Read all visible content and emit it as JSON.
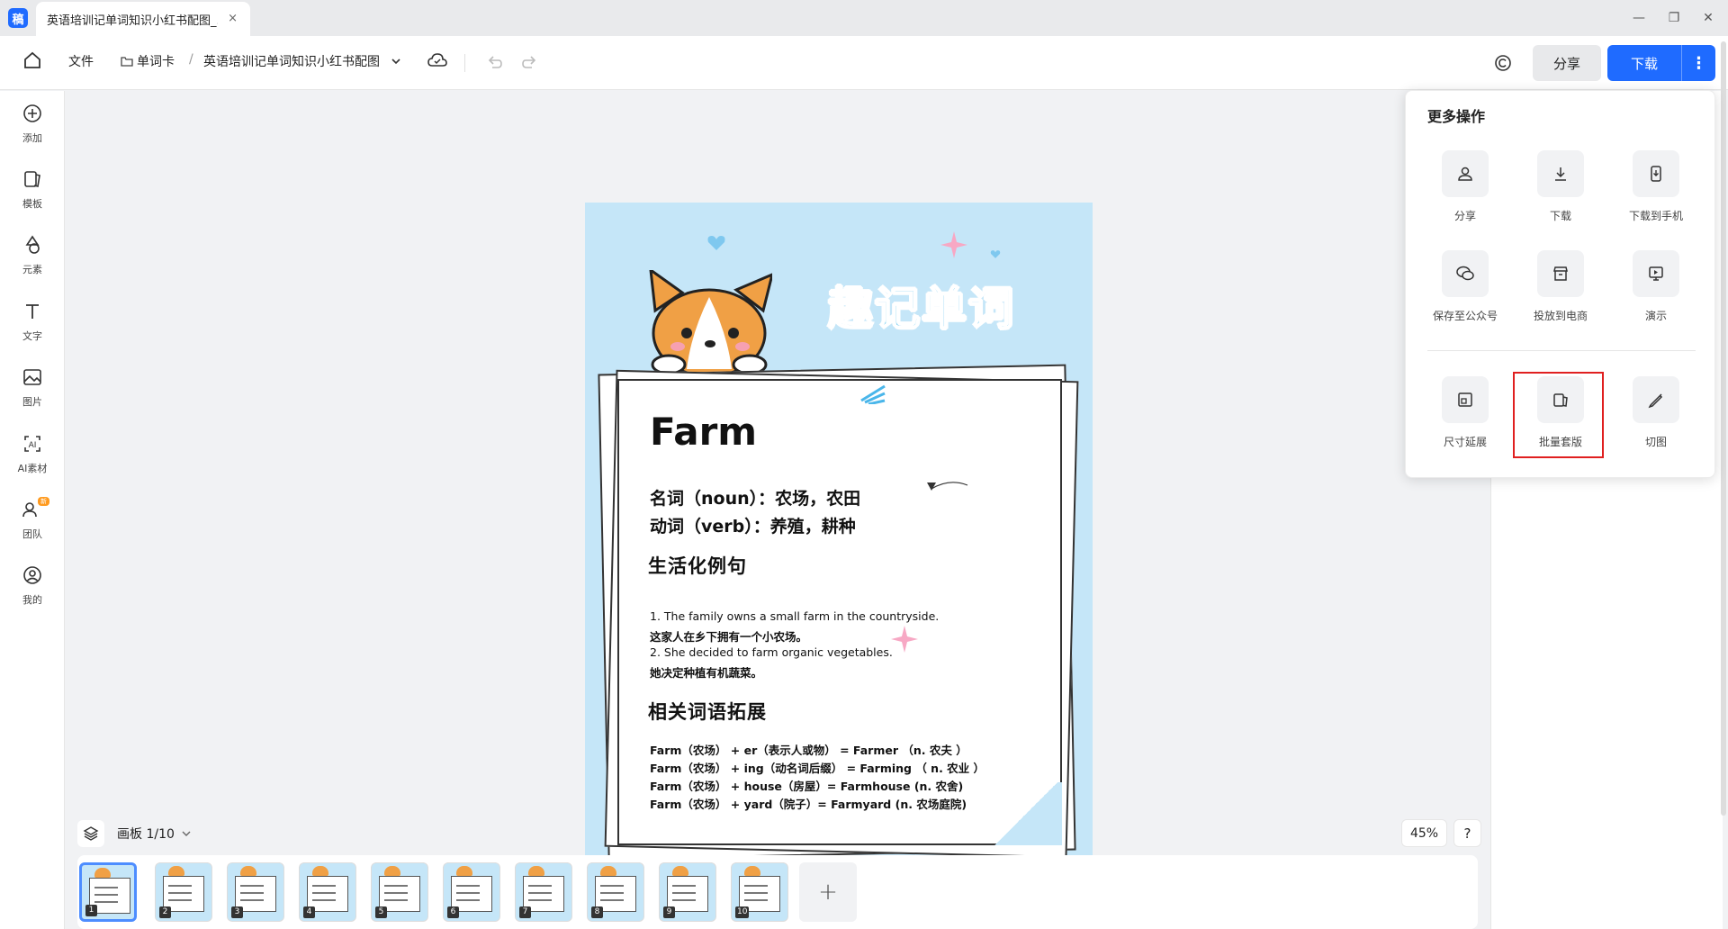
{
  "window": {
    "logo_text": "稿",
    "tab_title": "英语培训记单词知识小红书配图_...",
    "tab_close": "×",
    "minimize": "—",
    "restore": "❐",
    "close": "✕"
  },
  "toolbar": {
    "file_label": "文件",
    "folder_label": "单词卡",
    "separator": "/",
    "doc_title": "英语培训记单词知识小红书配图",
    "share_label": "分享",
    "download_label": "下载",
    "more_glyph": "⋮"
  },
  "sidebar": {
    "items": [
      {
        "label": "添加",
        "icon": "plus-circle-icon"
      },
      {
        "label": "模板",
        "icon": "template-icon"
      },
      {
        "label": "元素",
        "icon": "shapes-icon"
      },
      {
        "label": "文字",
        "icon": "text-icon"
      },
      {
        "label": "图片",
        "icon": "image-icon"
      },
      {
        "label": "AI素材",
        "icon": "ai-icon"
      },
      {
        "label": "团队",
        "icon": "team-icon"
      },
      {
        "label": "我的",
        "icon": "user-icon"
      }
    ],
    "team_badge": "新"
  },
  "poster": {
    "title": "趣记单词",
    "word": "Farm",
    "def_noun": "名词（noun）：农场，农田",
    "def_verb": "动词（verb）：养殖，耕种",
    "section_examples": "生活化例句",
    "sentences": [
      "1. The family owns a small farm in the countryside.",
      "这家人在乡下拥有一个小农场。",
      "2. She decided to farm organic vegetables.",
      "她决定种植有机蔬菜。"
    ],
    "section_extension": "相关词语拓展",
    "extensions": [
      "Farm（农场） + er（表示人或物） = Farmer （n. 农夫 ）",
      "Farm（农场） + ing（动名词后缀） = Farming （ n. 农业 ）",
      "Farm（农场） + house（房屋）= Farmhouse (n. 农舍)",
      "Farm（农场） + yard（院子）= Farmyard (n. 农场庭院)"
    ],
    "colors": {
      "background": "#c5e6f8",
      "title": "#5ec4ef"
    }
  },
  "bottom": {
    "board_label": "画板 1/10",
    "zoom": "45%",
    "help": "?",
    "add_page": "+",
    "pages": [
      "1",
      "2",
      "3",
      "4",
      "5",
      "6",
      "7",
      "8",
      "9",
      "10"
    ],
    "active_page": 1
  },
  "popover": {
    "title": "更多操作",
    "items": [
      {
        "label": "分享",
        "icon": "user-share-icon"
      },
      {
        "label": "下载",
        "icon": "download-icon"
      },
      {
        "label": "下载到手机",
        "icon": "phone-download-icon"
      },
      {
        "label": "保存至公众号",
        "icon": "wechat-icon"
      },
      {
        "label": "投放到电商",
        "icon": "shop-icon"
      },
      {
        "label": "演示",
        "icon": "present-icon"
      },
      {
        "label": "尺寸延展",
        "icon": "resize-icon"
      },
      {
        "label": "批量套版",
        "icon": "batch-template-icon"
      },
      {
        "label": "切图",
        "icon": "slice-icon"
      }
    ],
    "highlighted": "批量套版",
    "highlight_color": "#e02020"
  },
  "colors": {
    "accent": "#1f6bff"
  }
}
